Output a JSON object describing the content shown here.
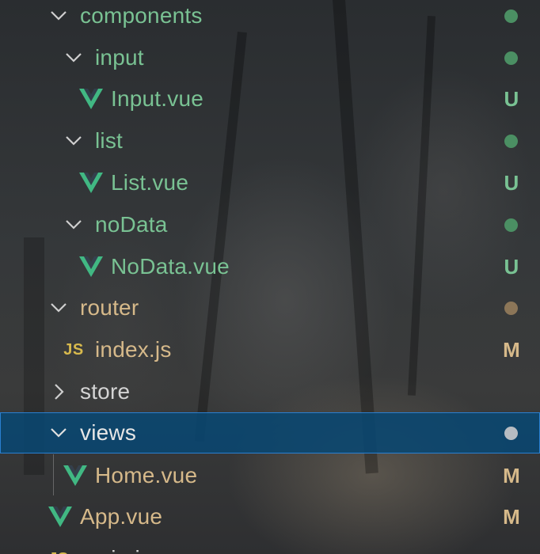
{
  "colors": {
    "untracked_green": "#79c293",
    "modified_tan": "#d6b98a",
    "plain_text": "#d4d4d4",
    "selection_bg": "#094771",
    "vue_icon": "#41b883",
    "js_icon": "#d7b94d"
  },
  "tree": {
    "items": [
      {
        "label": "components",
        "type": "folder",
        "expanded": true,
        "status": "",
        "icon": "chevron-down-icon"
      },
      {
        "label": "input",
        "type": "folder",
        "expanded": true,
        "status": "",
        "icon": "chevron-down-icon"
      },
      {
        "label": "Input.vue",
        "type": "file",
        "status": "U",
        "icon": "vue-icon"
      },
      {
        "label": "list",
        "type": "folder",
        "expanded": true,
        "status": "",
        "icon": "chevron-down-icon"
      },
      {
        "label": "List.vue",
        "type": "file",
        "status": "U",
        "icon": "vue-icon"
      },
      {
        "label": "noData",
        "type": "folder",
        "expanded": true,
        "status": "",
        "icon": "chevron-down-icon"
      },
      {
        "label": "NoData.vue",
        "type": "file",
        "status": "U",
        "icon": "vue-icon"
      },
      {
        "label": "router",
        "type": "folder",
        "expanded": true,
        "status": "",
        "icon": "chevron-down-icon"
      },
      {
        "label": "index.js",
        "type": "file",
        "status": "M",
        "icon": "js-icon",
        "icon_text": "JS"
      },
      {
        "label": "store",
        "type": "folder",
        "expanded": false,
        "status": "",
        "icon": "chevron-right-icon"
      },
      {
        "label": "views",
        "type": "folder",
        "expanded": true,
        "selected": true,
        "status": "",
        "icon": "chevron-down-icon"
      },
      {
        "label": "Home.vue",
        "type": "file",
        "status": "M",
        "icon": "vue-icon"
      },
      {
        "label": "App.vue",
        "type": "file",
        "status": "M",
        "icon": "vue-icon"
      },
      {
        "label": "main.js",
        "type": "file",
        "status": "",
        "icon": "js-icon",
        "icon_text": "JS"
      }
    ]
  }
}
